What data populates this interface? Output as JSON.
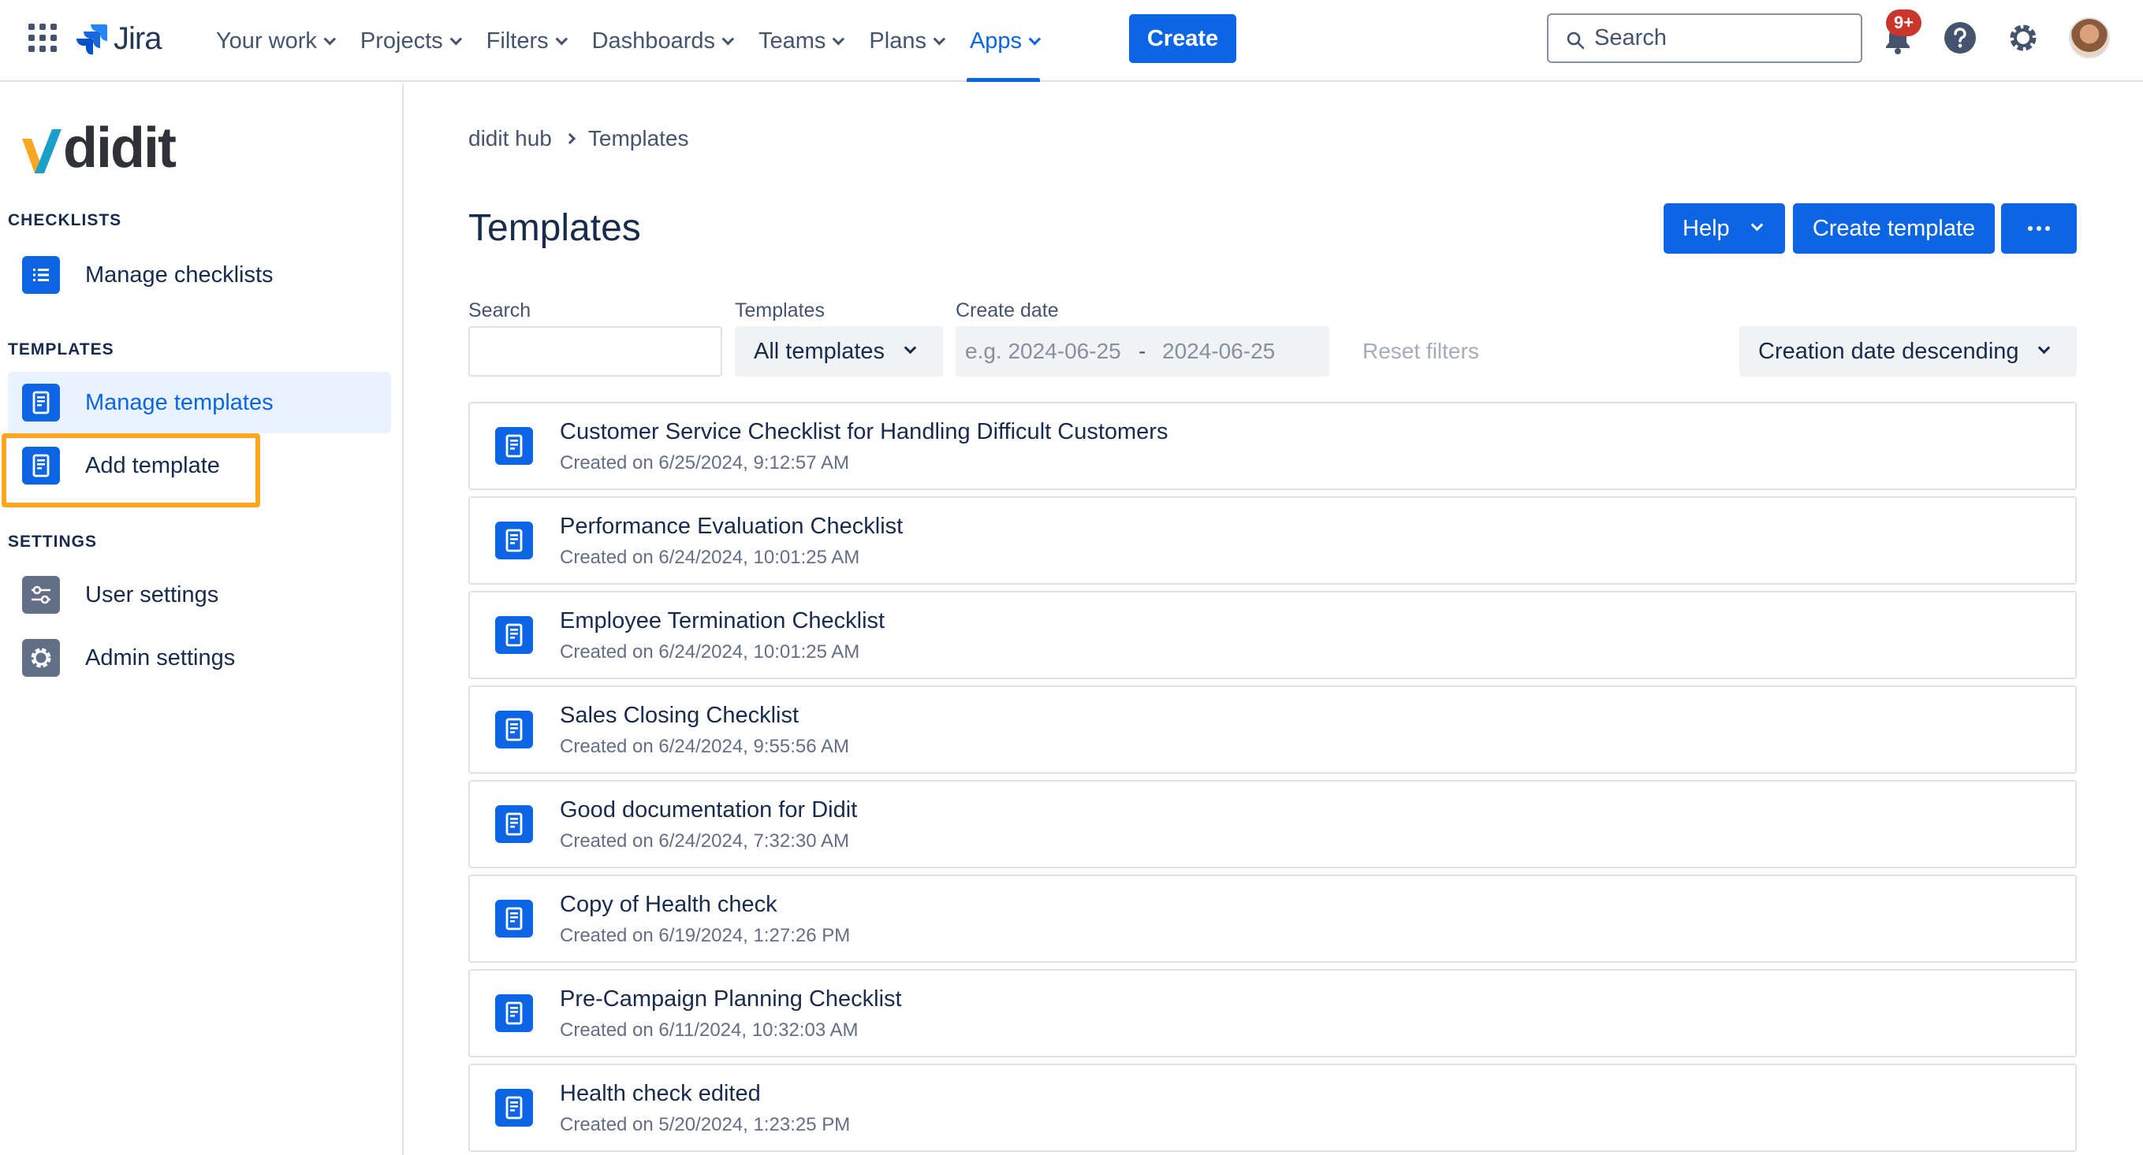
{
  "topnav": {
    "product": "Jira",
    "items": [
      {
        "label": "Your work"
      },
      {
        "label": "Projects"
      },
      {
        "label": "Filters"
      },
      {
        "label": "Dashboards"
      },
      {
        "label": "Teams"
      },
      {
        "label": "Plans"
      },
      {
        "label": "Apps",
        "active": true
      }
    ],
    "create_label": "Create",
    "search_placeholder": "Search",
    "notifications_badge": "9+",
    "icons": [
      "app-switcher-icon",
      "jira-logo-icon",
      "search-icon",
      "bell-icon",
      "help-icon",
      "gear-icon",
      "avatar"
    ]
  },
  "sidebar": {
    "brand": "didit",
    "sections": {
      "checklists": "CHECKLISTS",
      "templates": "TEMPLATES",
      "settings": "SETTINGS"
    },
    "items": {
      "manage_checklists": "Manage checklists",
      "manage_templates": "Manage templates",
      "add_template": "Add template",
      "user_settings": "User settings",
      "admin_settings": "Admin settings"
    }
  },
  "breadcrumb": {
    "root": "didit hub",
    "current": "Templates"
  },
  "page": {
    "title": "Templates",
    "help_label": "Help",
    "create_template_label": "Create template"
  },
  "filters": {
    "search_label": "Search",
    "search_value": "",
    "templates_label": "Templates",
    "templates_value": "All templates",
    "create_date_label": "Create date",
    "date_from_placeholder": "e.g. 2024-06-25",
    "date_separator": "-",
    "date_to_placeholder": "2024-06-25",
    "reset_label": "Reset filters",
    "sort_value": "Creation date descending"
  },
  "templates": [
    {
      "title": "Customer Service Checklist for Handling Difficult Customers",
      "created": "Created on 6/25/2024, 9:12:57 AM"
    },
    {
      "title": "Performance Evaluation Checklist",
      "created": "Created on 6/24/2024, 10:01:25 AM"
    },
    {
      "title": "Employee Termination Checklist",
      "created": "Created on 6/24/2024, 10:01:25 AM"
    },
    {
      "title": "Sales Closing Checklist",
      "created": "Created on 6/24/2024, 9:55:56 AM"
    },
    {
      "title": "Good documentation for Didit",
      "created": "Created on 6/24/2024, 7:32:30 AM"
    },
    {
      "title": "Copy of Health check",
      "created": "Created on 6/19/2024, 1:27:26 PM"
    },
    {
      "title": "Pre-Campaign Planning Checklist",
      "created": "Created on 6/11/2024, 10:32:03 AM"
    },
    {
      "title": "Health check edited",
      "created": "Created on 5/20/2024, 1:23:25 PM"
    }
  ],
  "colors": {
    "brand_blue": "#0c66e4",
    "highlight_orange": "#ffa51f",
    "notification_red": "#c9372c",
    "settings_icon_gray": "#626f86"
  }
}
